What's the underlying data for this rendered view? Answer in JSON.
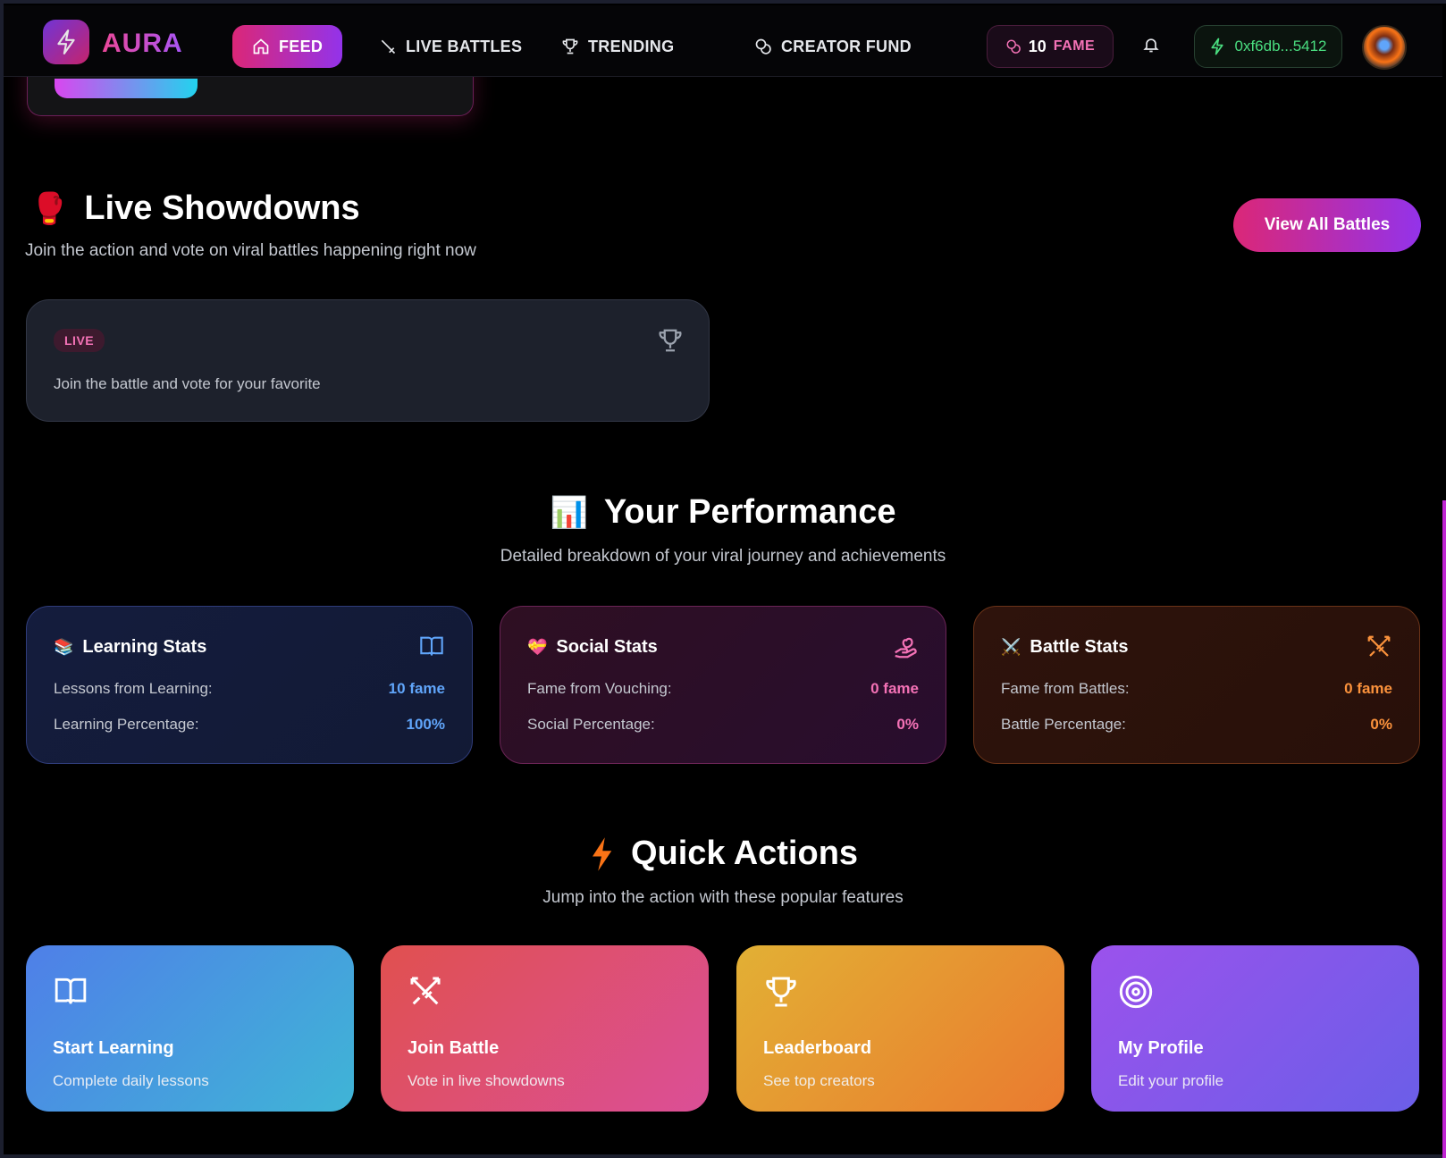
{
  "nav": {
    "brand": "AURA",
    "links": [
      {
        "label": "FEED",
        "icon": "home-icon",
        "active": true
      },
      {
        "label": "LIVE BATTLES",
        "icon": "sword-icon",
        "active": false
      },
      {
        "label": "TRENDING",
        "icon": "trophy-icon",
        "active": false
      },
      {
        "label": "CREATOR FUND",
        "icon": "coins-icon",
        "active": false
      }
    ],
    "fame_count": "10",
    "fame_unit": "FAME",
    "wallet": "0xf6db...5412"
  },
  "live_showdowns": {
    "emoji": "🥊",
    "title": "Live Showdowns",
    "subtitle": "Join the action and vote on viral battles happening right now",
    "view_all": "View All Battles",
    "battle_card": {
      "badge": "LIVE",
      "description": "Join the battle and vote for your favorite"
    }
  },
  "performance": {
    "emoji": "📊",
    "title": "Your Performance",
    "subtitle": "Detailed breakdown of your viral journey and achievements",
    "cards": [
      {
        "emoji": "📚",
        "title": "Learning Stats",
        "icon": "book-icon",
        "rows": [
          {
            "label": "Lessons from Learning:",
            "value": "10 fame"
          },
          {
            "label": "Learning Percentage:",
            "value": "100%"
          }
        ]
      },
      {
        "emoji": "💝",
        "title": "Social Stats",
        "icon": "heart-hand-icon",
        "rows": [
          {
            "label": "Fame from Vouching:",
            "value": "0 fame"
          },
          {
            "label": "Social Percentage:",
            "value": "0%"
          }
        ]
      },
      {
        "emoji": "⚔️",
        "title": "Battle Stats",
        "icon": "crossed-swords-icon",
        "rows": [
          {
            "label": "Fame from Battles:",
            "value": "0 fame"
          },
          {
            "label": "Battle Percentage:",
            "value": "0%"
          }
        ]
      }
    ]
  },
  "quick_actions": {
    "title": "Quick Actions",
    "subtitle": "Jump into the action with these popular features",
    "items": [
      {
        "title": "Start Learning",
        "subtitle": "Complete daily lessons",
        "icon": "book-icon"
      },
      {
        "title": "Join Battle",
        "subtitle": "Vote in live showdowns",
        "icon": "crossed-swords-icon"
      },
      {
        "title": "Leaderboard",
        "subtitle": "See top creators",
        "icon": "trophy-icon"
      },
      {
        "title": "My Profile",
        "subtitle": "Edit your profile",
        "icon": "target-icon"
      }
    ]
  },
  "colors": {
    "accent_pink": "#db2777",
    "accent_purple": "#9333ea",
    "learning": "#60a5fa",
    "social": "#f472b6",
    "battle": "#fb923c",
    "wallet_green": "#4ade80"
  }
}
